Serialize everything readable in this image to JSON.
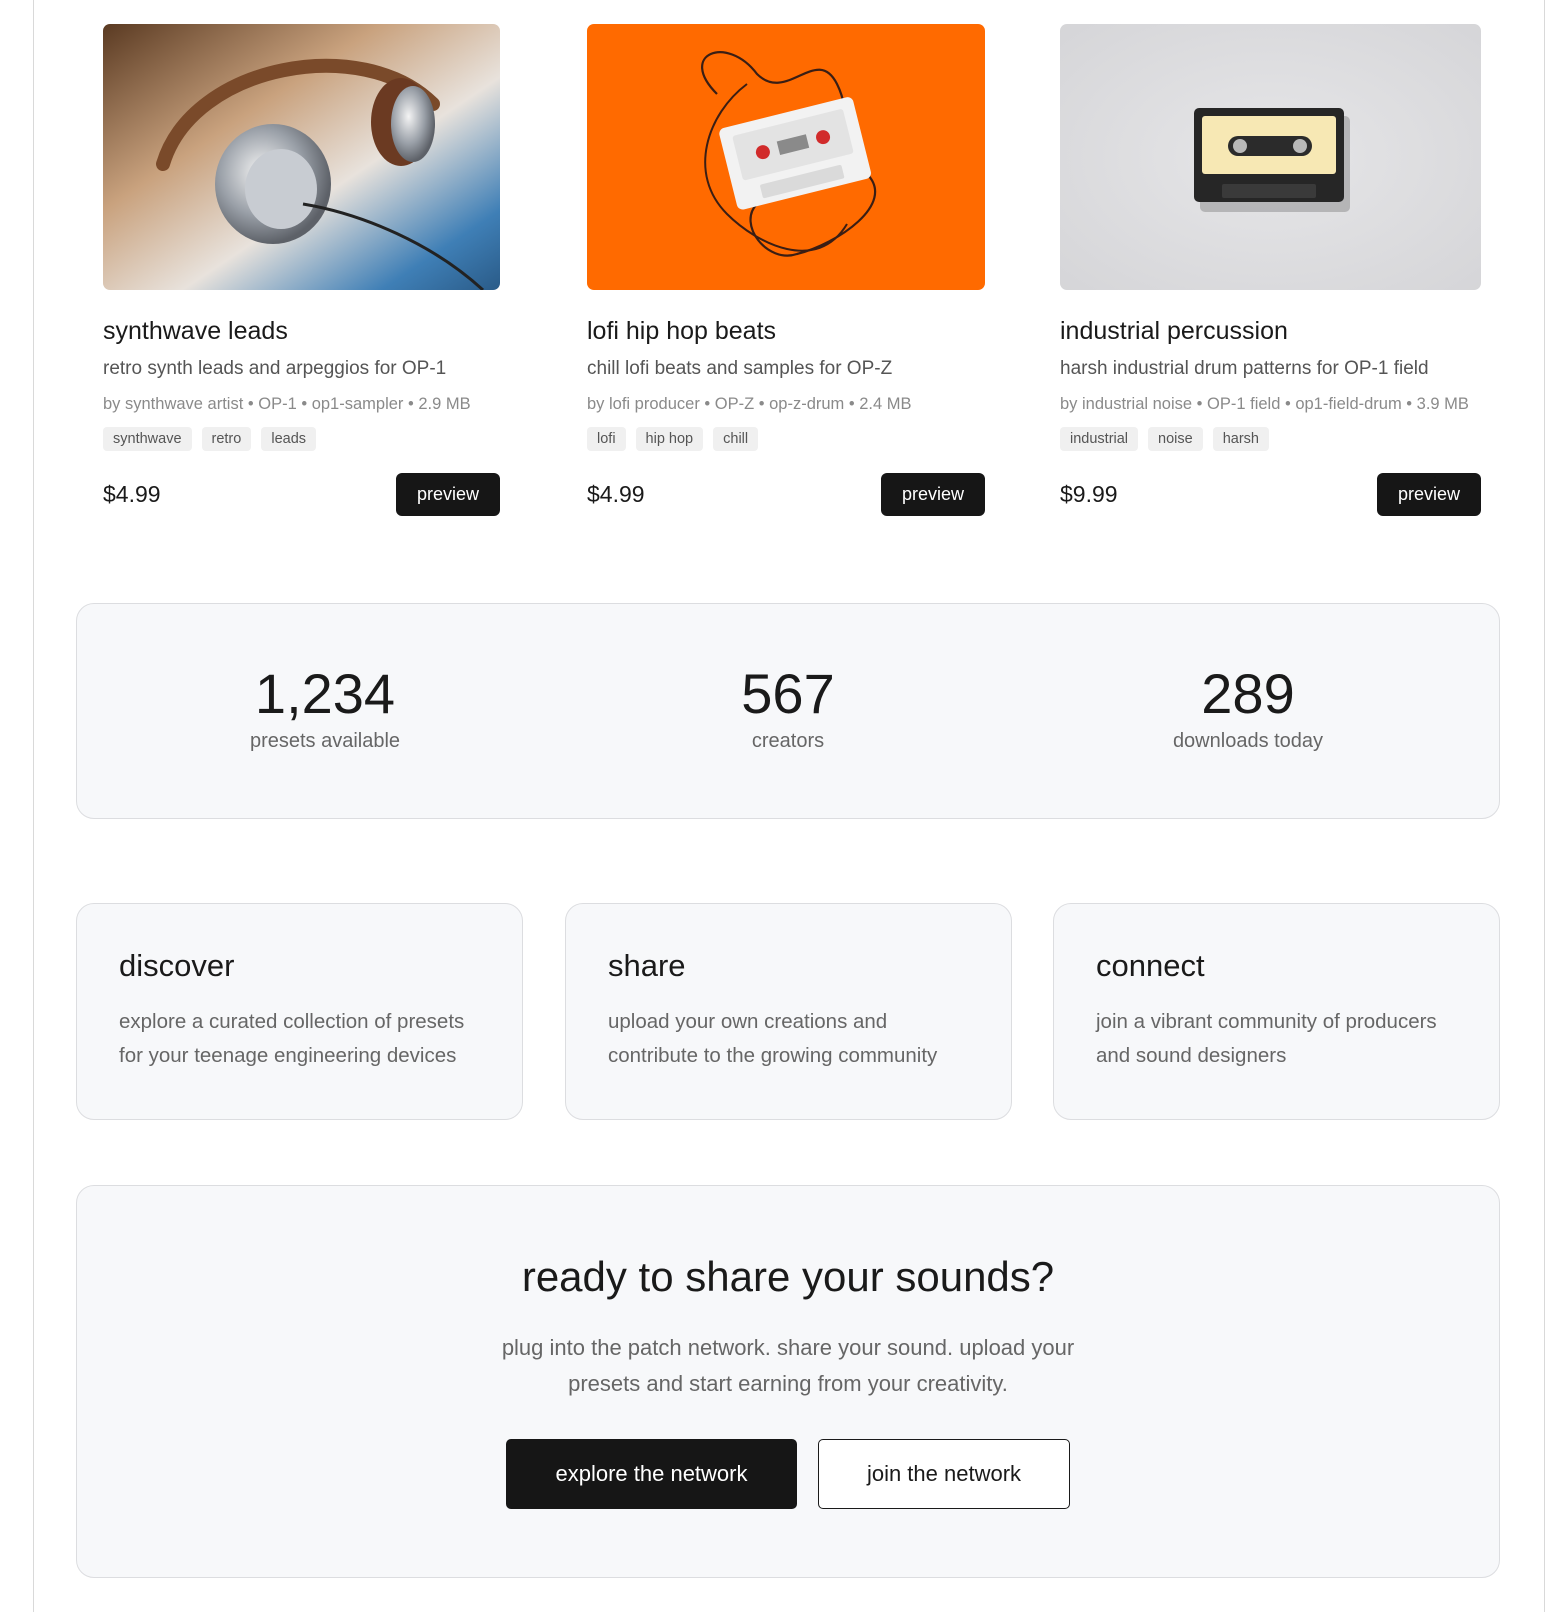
{
  "products": [
    {
      "image": "headphones-photo",
      "name": "synthwave leads",
      "description": "retro synth leads and arpeggios for OP-1",
      "meta": "by synthwave artist • OP-1 • op1-sampler • 2.9 MB",
      "tags": [
        "synthwave",
        "retro",
        "leads"
      ],
      "price": "$4.99",
      "button": "preview"
    },
    {
      "image": "cassette-on-orange-photo",
      "name": "lofi hip hop beats",
      "description": "chill lofi beats and samples for OP-Z",
      "meta": "by lofi producer • OP-Z • op-z-drum • 2.4 MB",
      "tags": [
        "lofi",
        "hip hop",
        "chill"
      ],
      "price": "$4.99",
      "button": "preview"
    },
    {
      "image": "black-cassette-photo",
      "name": "industrial percussion",
      "description": "harsh industrial drum patterns for OP-1 field",
      "meta": "by industrial noise • OP-1 field • op1-field-drum • 3.9 MB",
      "tags": [
        "industrial",
        "noise",
        "harsh"
      ],
      "price": "$9.99",
      "button": "preview"
    }
  ],
  "stats": [
    {
      "value": "1,234",
      "label": "presets available"
    },
    {
      "value": "567",
      "label": "creators"
    },
    {
      "value": "289",
      "label": "downloads today"
    }
  ],
  "features": [
    {
      "title": "discover",
      "text": "explore a curated collection of presets for your teenage engineering devices"
    },
    {
      "title": "share",
      "text": "upload your own creations and contribute to the growing community"
    },
    {
      "title": "connect",
      "text": "join a vibrant community of producers and sound designers"
    }
  ],
  "cta": {
    "title": "ready to share your sounds?",
    "text": "plug into the patch network. share your sound. upload your presets and start earning from your creativity.",
    "primary": "explore the network",
    "secondary": "join the network"
  },
  "colors": {
    "accent": "#161616",
    "panel": "#f7f8fa",
    "orange": "#ff6a00"
  }
}
